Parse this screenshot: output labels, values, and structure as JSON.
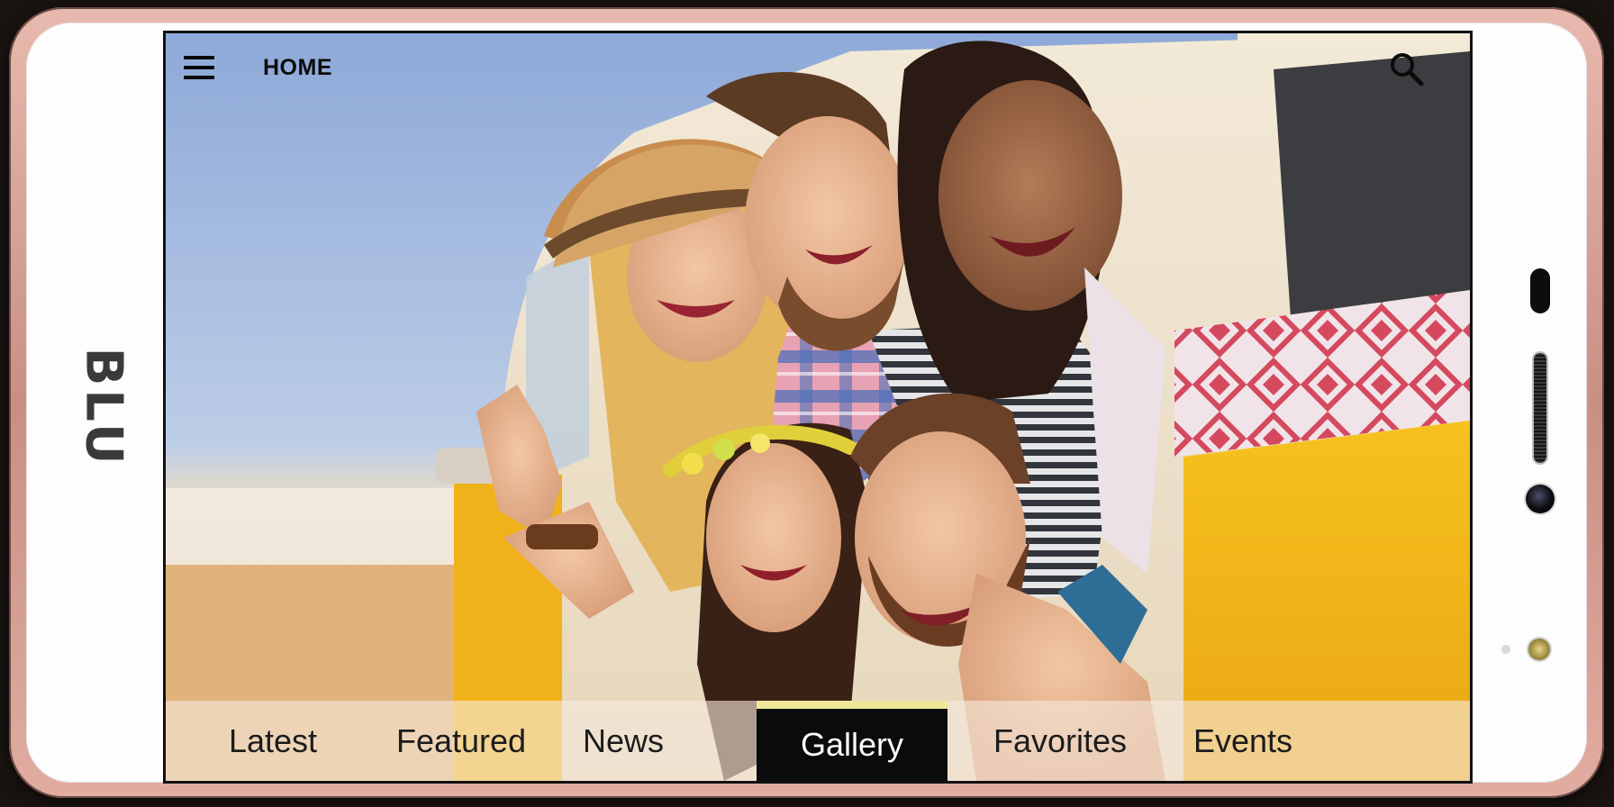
{
  "device": {
    "brand": "BLU"
  },
  "header": {
    "title": "HOME",
    "menu_icon": "hamburger-menu-icon",
    "search_icon": "search-icon"
  },
  "hero_image": {
    "subject": "photo"
  },
  "tabs": [
    {
      "label": "Latest",
      "active": false
    },
    {
      "label": "Featured",
      "active": false
    },
    {
      "label": "News",
      "active": false
    },
    {
      "label": "Gallery",
      "active": true
    },
    {
      "label": "Favorites",
      "active": false
    },
    {
      "label": "Events",
      "active": false
    }
  ],
  "colors": {
    "active_tab_bg": "#0b0b0b",
    "active_tab_indicator": "#efe79a",
    "phone_frame": "#d9a397"
  }
}
